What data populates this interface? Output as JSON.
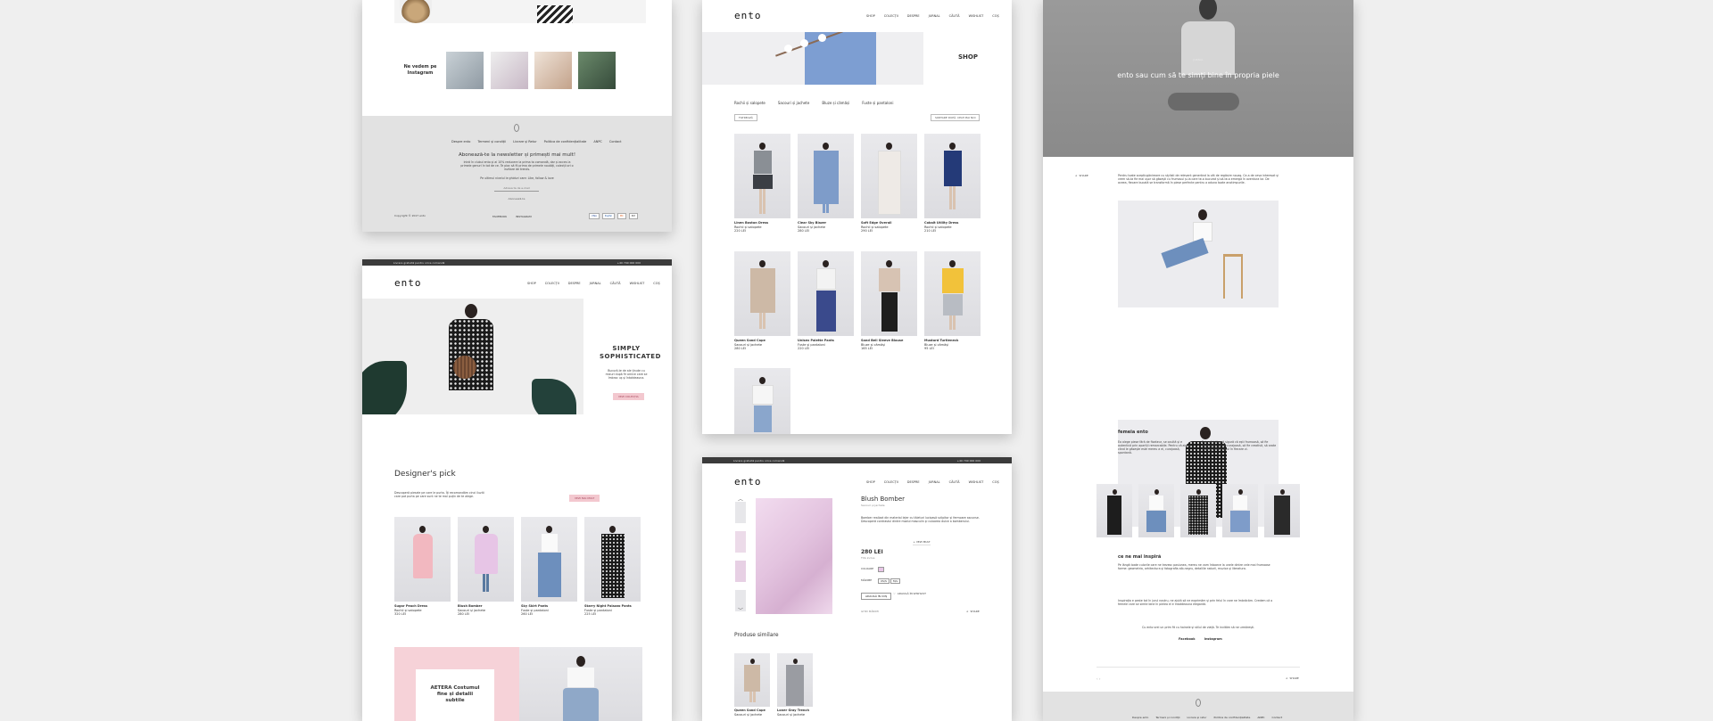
{
  "brand": "ento",
  "nav": [
    "SHOP",
    "COLECȚII",
    "DESPRE",
    "JURNAL",
    "CĂUTĂ",
    "WISHLIST",
    "COȘ"
  ],
  "topbar": {
    "left": "Livrare gratuită pentru orice comandă",
    "right": "+40 799 000 000"
  },
  "panel1": {
    "instagram_label": "Ne vedem pe Instagram",
    "footer_links": [
      "Despre ento",
      "Termeni și condiții",
      "Livrare și Retur",
      "Politica de confidențialitate",
      "ANPC",
      "Contact"
    ],
    "newsletter_title": "Abonează-te la newsletter și primești mai mult!",
    "newsletter_text": "Intră în clubul ento și ai 10% reducere la prima ta comandă, dar și acces la primele genuri în tot de ce. Te plac să fii prima de primele noutăți, colecții ori o invitare de trends.",
    "newsletter_note": "Pe ultimul nivelul le ghiduri care: Like, follow & love",
    "email_placeholder": "Adresa ta de e-mail",
    "subscribe": "Abonează-te",
    "copyright": "Copyright © 2017 ento",
    "social": [
      "FACEBOOK",
      "INSTAGRAM"
    ],
    "payments": [
      "VISA",
      "PayPal",
      "MC",
      "PAY"
    ]
  },
  "panel2": {
    "hero_title": "SIMPLY SOPHISTICATED",
    "hero_text": "Bucură-te de ale ținute cu mixuri după fir ornice care se îmbrac uș și întotdeauna.",
    "hero_btn": "VEZI COLECȚIA",
    "section_title": "Designer's pick",
    "section_text": "Descoperă piesele pe care le purta. Îți recomandăm cinci iluziti care pot purta pe care sunt ne te mai puțin de te alege.",
    "section_btn": "VEZI MAI MULT",
    "products": [
      {
        "name": "Sugar Peach Dress",
        "cat": "Rochii și salopete",
        "price": "320 LEI"
      },
      {
        "name": "Blush Bomber",
        "cat": "Sacouri și jachete",
        "price": "280 LEI"
      },
      {
        "name": "Sky Skirt Pants",
        "cat": "Fuste și pantaloni",
        "price": "260 LEI"
      },
      {
        "name": "Starry Night Palazzo Pants",
        "cat": "Fuste și pantaloni",
        "price": "225 LEI"
      }
    ],
    "promo_title": "AETERA Costumul fine și detalii subtile"
  },
  "panel3": {
    "shop_title": "SHOP",
    "tabs": [
      "Rochii și salopete",
      "Sacouri și jachete",
      "Bluze și cămăși",
      "Fuste și pantaloni"
    ],
    "filter": "FILTREAZĂ",
    "sort": "SORTARE DUPĂ: CELE MAI NOI",
    "products": [
      {
        "name": "Linen Boston Dress",
        "cat": "Rochii și salopete",
        "price": "220 LEI"
      },
      {
        "name": "Clear Sky Blazer",
        "cat": "Sacouri și jachete",
        "price": "280 LEI"
      },
      {
        "name": "Soft Edge Overall",
        "cat": "Rochii și salopete",
        "price": "290 LEI"
      },
      {
        "name": "Cobalt Utility Dress",
        "cat": "Rochii și salopete",
        "price": "210 LEI"
      },
      {
        "name": "Queen Sand Cape",
        "cat": "Sacouri și jachete",
        "price": "280 LEI"
      },
      {
        "name": "Unisex Palette Pants",
        "cat": "Fuste și pantaloni",
        "price": "220 LEI"
      },
      {
        "name": "Sand Bell Sleeve Blouse",
        "cat": "Bluze și cămăși",
        "price": "165 LEI"
      },
      {
        "name": "Mustard Turtleneck",
        "cat": "Bluze și cămăși",
        "price": "95 LEI"
      }
    ]
  },
  "panel4": {
    "product_name": "Blush Bomber",
    "product_cat": "Sacouri și jachete",
    "product_desc": "Bomber realizat din material lejer cu tăieturi lucioasă sclipitor și fermoare ascunse. Descoperă contrastul dintre modul masculin și culoarea dulce a bomberului.",
    "more": "+ VEZI MULT",
    "price": "280 LEI",
    "price_note": "TVA inclus",
    "color_label": "CULOARE",
    "size_label": "MĂRIME",
    "sizes": [
      "XS/S",
      "M/L"
    ],
    "add_btn": "ADAUGĂ ÎN COȘ",
    "wishlist": "ADAUGĂ ÎN WISHLIST",
    "guide": "GHID MĂRIMI",
    "share": "SHARE",
    "similar_title": "Produse similare",
    "similar": [
      {
        "name": "Queen Sand Cape",
        "cat": "Sacouri și jachete"
      },
      {
        "name": "Loner Gray Trench",
        "cat": "Sacouri și jachete"
      }
    ]
  },
  "panel5": {
    "kicker": "JURNAL",
    "hero_title": "ento sau cum să te simți bine în propria piele",
    "share": "SHARE",
    "intro": "Pentru toate scepticgănireare cu stylisti de relevant generând la cât de regăsire nouaș. Ce-a de ceva interesat și vrem să-ta fie mai ușor să găsești cu frumosul și-la care te-a bucurat și să-te-a emergă în aventura lor. De aceea, fiecare bucată se transformă în piese perfecte pentru a aduna toate anotimpurile.",
    "femeia_title": "femeia ento",
    "femeia_text1": "Ea alege piese fără de fixateur, se ocultă și e autentică prin apariții remarcabile. Pentru că alunei când le găsește este mereu a ei, curajoasă, spontană.",
    "femeia_text2": "Este să trăiască sigură că ești frumoasă, să fie dezinvoltă, să fie curajoasă, să fie creativă, să arate și să-și cultive stilul în fiecare zi.",
    "inspira_title": "ce ne mai inspiră",
    "inspira_text1": "Pe lângă toate culorile care ne trezesc pasiunea, mereu ne vom întoarce la unele dintre cele mai frumoase forme: geometria, arhitectura și fotografia alb-negru, detaliile naturii, muzica și literatura.",
    "inspira_text2": "Inspirația e peste tot în jurul nostru, ne ajută să ne exprimăm și prin felul în care ne îmbrăcăm. Credem că o femeie care se simte bine în pielea ei e întotdeauna elegantă.",
    "inspira_text3": "Cu ento vrei un prim fit cu hainele și stilul de viață. Te invităm să ne urmărești.",
    "social": [
      "Facebook",
      "Instagram"
    ],
    "footer_links": [
      "Despre ento",
      "Termeni și condiții",
      "Livrare și retur",
      "Politica de confidențialitate",
      "ANPC",
      "Contact"
    ]
  }
}
